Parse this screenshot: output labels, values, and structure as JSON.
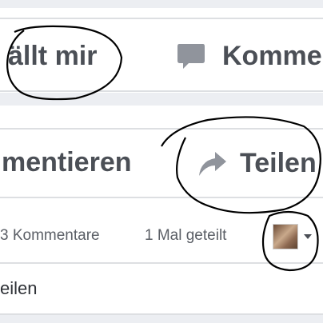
{
  "top_bar": {
    "like_label": "ällt mir",
    "comment_label": "Komme"
  },
  "second_bar": {
    "comment_label": "mentieren",
    "share_label": "Teilen"
  },
  "meta_row": {
    "comments_count": "3 Kommentare",
    "shares_count": "1 Mal geteilt"
  },
  "bottom_row": {
    "share_label": "eilen"
  },
  "icons": {
    "comment": "speech-bubble-icon",
    "share": "share-arrow-icon",
    "dropdown": "caret-down-icon"
  },
  "colors": {
    "text": "#4b4f56",
    "icon": "#90949c",
    "annotation_ink": "#000000"
  }
}
